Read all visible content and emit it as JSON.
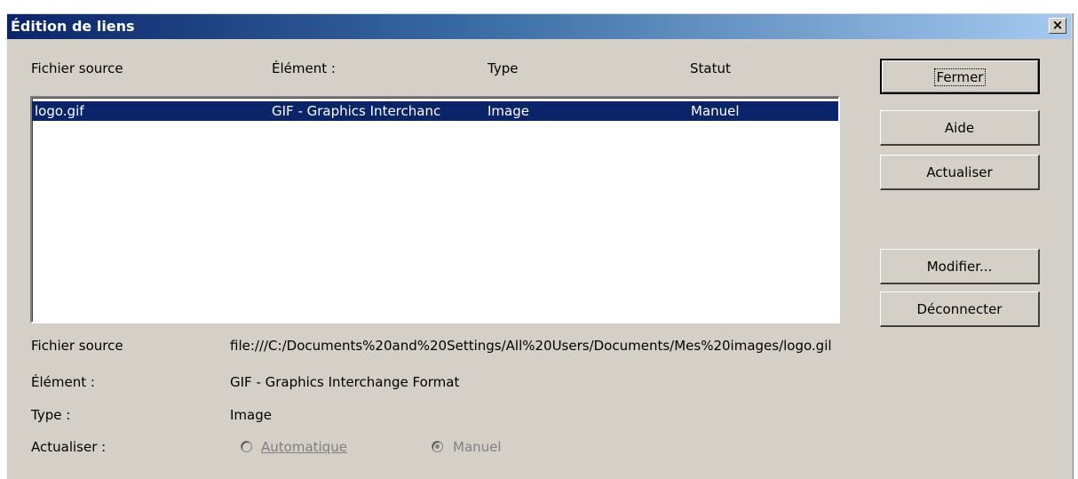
{
  "window": {
    "title": "Édition de liens",
    "close_label": "×"
  },
  "columns": {
    "source": "Fichier source",
    "element": "Élément :",
    "type": "Type",
    "status": "Statut"
  },
  "rows": [
    {
      "source": "logo.gif",
      "element": "GIF - Graphics Interchanc",
      "type": "Image",
      "status": "Manuel"
    }
  ],
  "buttons": {
    "close": "Fermer",
    "help": "Aide",
    "refresh": "Actualiser",
    "modify": "Modifier...",
    "disconnect": "Déconnecter"
  },
  "details": {
    "source_label": "Fichier source",
    "source_value": "file:///C:/Documents%20and%20Settings/All%20Users/Documents/Mes%20images/logo.gil",
    "element_label": "Élément :",
    "element_value": "GIF - Graphics Interchange Format",
    "type_label": "Type :",
    "type_value": "Image",
    "update_label": "Actualiser :",
    "auto_option": "Automatique",
    "manual_option": "Manuel",
    "selected_option": "Manuel"
  },
  "colors": {
    "face": "#d4d0c8",
    "title_start": "#0a246a",
    "title_end": "#a6caf0",
    "selection": "#0a246a"
  }
}
